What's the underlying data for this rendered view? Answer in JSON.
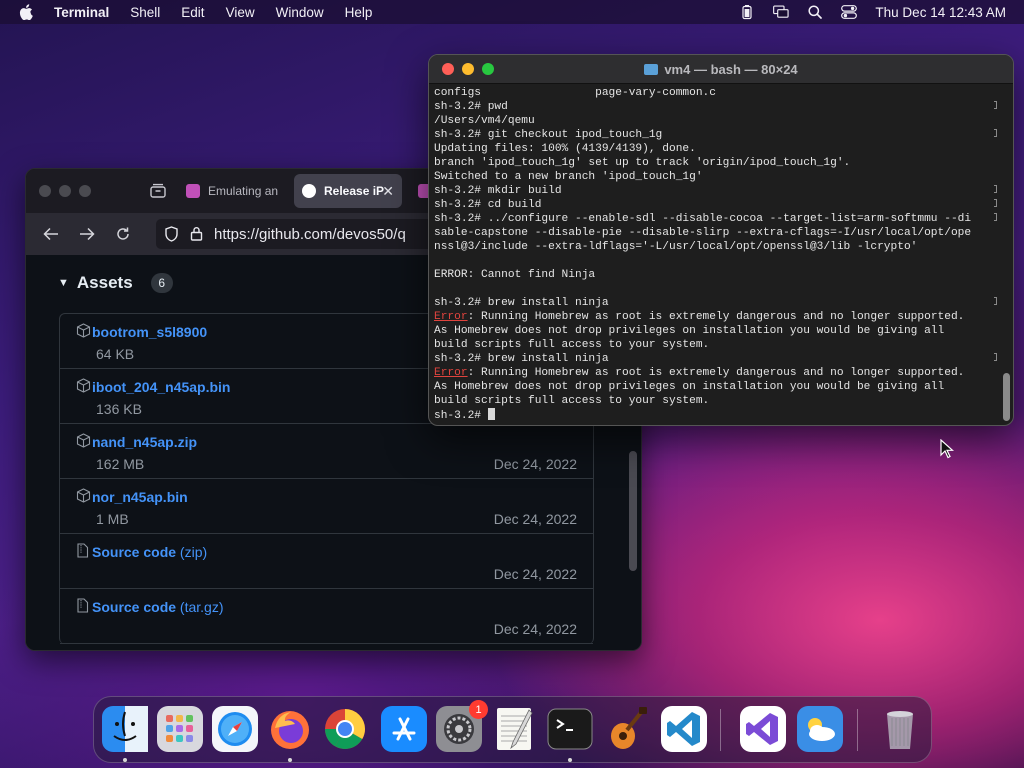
{
  "menubar": {
    "app_name": "Terminal",
    "menus": [
      "Shell",
      "Edit",
      "View",
      "Window",
      "Help"
    ],
    "clock": "Thu Dec 14  12:43 AM"
  },
  "browser": {
    "tabs": [
      {
        "label": "Emulating an"
      },
      {
        "label": "Release iP"
      }
    ],
    "url": "https://github.com/devos50/q",
    "assets": {
      "title": "Assets",
      "count": "6",
      "items": [
        {
          "name_bold": "bootrom_s5l8900",
          "name_rest": "",
          "size": "64 KB",
          "date": ""
        },
        {
          "name_bold": "iboot_204_n45ap.bin",
          "name_rest": "",
          "size": "136 KB",
          "date": ""
        },
        {
          "name_bold": "nand_n45ap.zip",
          "name_rest": "",
          "size": "162 MB",
          "date": "Dec 24, 2022"
        },
        {
          "name_bold": "nor_n45ap.bin",
          "name_rest": "",
          "size": "1 MB",
          "date": "Dec 24, 2022"
        },
        {
          "name_bold": "Source code",
          "name_rest": " (zip)",
          "size": "",
          "date": "Dec 24, 2022"
        },
        {
          "name_bold": "Source code",
          "name_rest": " (tar.gz)",
          "size": "",
          "date": "Dec 24, 2022"
        }
      ]
    }
  },
  "terminal": {
    "title": "vm4 — bash — 80×24",
    "lines": [
      "configs                 page-vary-common.c",
      "sh-3.2# pwd",
      "/Users/vm4/qemu",
      "sh-3.2# git checkout ipod_touch_1g",
      "Updating files: 100% (4139/4139), done.",
      "branch 'ipod_touch_1g' set up to track 'origin/ipod_touch_1g'.",
      "Switched to a new branch 'ipod_touch_1g'",
      "sh-3.2# mkdir build",
      "sh-3.2# cd build",
      "sh-3.2# ../configure --enable-sdl --disable-cocoa --target-list=arm-softmmu --di",
      "sable-capstone --disable-pie --disable-slirp --extra-cflags=-I/usr/local/opt/ope",
      "nssl@3/include --extra-ldflags='-L/usr/local/opt/openssl@3/lib -lcrypto'",
      "",
      "ERROR: Cannot find Ninja",
      "",
      "sh-3.2# brew install ninja",
      "Error: Running Homebrew as root is extremely dangerous and no longer supported.",
      "As Homebrew does not drop privileges on installation you would be giving all",
      "build scripts full access to your system.",
      "sh-3.2# brew install ninja",
      "Error: Running Homebrew as root is extremely dangerous and no longer supported.",
      "As Homebrew does not drop privileges on installation you would be giving all",
      "build scripts full access to your system.",
      "sh-3.2# "
    ]
  },
  "dock": {
    "badge_count": "1",
    "apps": [
      {
        "name": "finder-icon",
        "color": "#2b8cf0",
        "running": true
      },
      {
        "name": "launchpad-icon",
        "color": "#d8d8de",
        "running": false
      },
      {
        "name": "safari-icon",
        "color": "#eaf3ff",
        "running": false
      },
      {
        "name": "firefox-icon",
        "color": "#ff7139",
        "running": true
      },
      {
        "name": "chrome-icon",
        "color": "#ffffff",
        "running": false
      },
      {
        "name": "app-store-icon",
        "color": "#1a8cff",
        "running": false
      },
      {
        "name": "system-settings-icon",
        "color": "#8e8e93",
        "running": false
      },
      {
        "name": "textedit-icon",
        "color": "#f4f4f0",
        "running": false
      },
      {
        "name": "terminal-icon",
        "color": "#1a1a1a",
        "running": true
      },
      {
        "name": "garageband-icon",
        "color": "#e8862a",
        "running": false
      },
      {
        "name": "vscode-icon",
        "color": "#ffffff",
        "running": false
      },
      {
        "name": "visual-studio-icon",
        "color": "#ffffff",
        "running": false
      },
      {
        "name": "weather-icon",
        "color": "#3a8ee6",
        "running": false
      },
      {
        "name": "trash-icon",
        "color": "#9a9aa2",
        "running": false
      }
    ]
  }
}
